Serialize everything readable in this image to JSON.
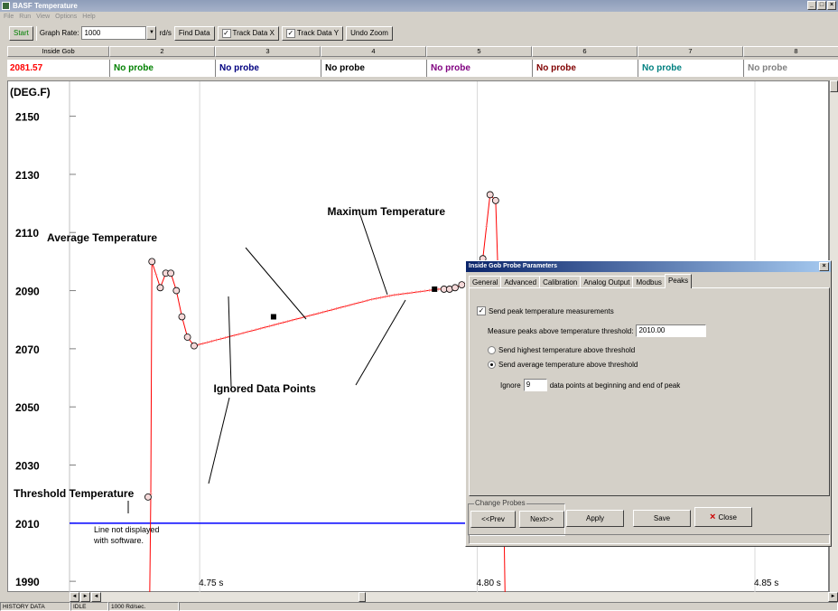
{
  "window": {
    "title": "BASF Temperature",
    "controls": [
      "_",
      "□",
      "×"
    ]
  },
  "menu": [
    "File",
    "Run",
    "View",
    "Options",
    "Help"
  ],
  "toolbar": {
    "start_label": "Start",
    "graph_rate_label": "Graph Rate:",
    "graph_rate_value": "1000",
    "graph_rate_unit": "rd/s",
    "find_data_label": "Find Data",
    "track_x_label": "Track Data X",
    "track_y_label": "Track Data Y",
    "undo_zoom_label": "Undo Zoom",
    "check_mark": "✓"
  },
  "channels": [
    {
      "header": "Inside Gob",
      "value": "2081.57",
      "color": "#ff0000"
    },
    {
      "header": "2",
      "value": "No probe",
      "color": "#008000"
    },
    {
      "header": "3",
      "value": "No probe",
      "color": "#000080"
    },
    {
      "header": "4",
      "value": "No probe",
      "color": "#000000"
    },
    {
      "header": "5",
      "value": "No probe",
      "color": "#800080"
    },
    {
      "header": "6",
      "value": "No probe",
      "color": "#800000"
    },
    {
      "header": "7",
      "value": "No probe",
      "color": "#008080"
    },
    {
      "header": "8",
      "value": "No probe",
      "color": "#808080"
    }
  ],
  "chart_data": {
    "type": "line",
    "ylabel": "(DEG.F)",
    "y_ticks": [
      "2150",
      "2130",
      "2110",
      "2090",
      "2070",
      "2050",
      "2030",
      "2010",
      "1990"
    ],
    "x_ticks": [
      "4.75 s",
      "4.80 s",
      "4.85 s"
    ],
    "ylim": [
      1986,
      2162
    ],
    "xlim": [
      4.7155,
      4.8635
    ],
    "grid": true,
    "threshold": 2010,
    "threshold_color": "#0000ff",
    "series_color": "#ff0000",
    "series": [
      {
        "values": [
          [
            4.741,
            1985
          ],
          [
            4.7412,
            2020
          ],
          [
            4.7414,
            2100
          ],
          [
            4.7429,
            2091
          ],
          [
            4.7439,
            2096
          ],
          [
            4.7448,
            2096
          ],
          [
            4.7458,
            2090
          ],
          [
            4.7468,
            2081
          ],
          [
            4.7478,
            2074
          ],
          [
            4.749,
            2071
          ],
          [
            4.753,
            2073
          ],
          [
            4.757,
            2075
          ],
          [
            4.761,
            2077
          ],
          [
            4.765,
            2079
          ],
          [
            4.769,
            2081
          ],
          [
            4.773,
            2083
          ],
          [
            4.777,
            2085
          ],
          [
            4.781,
            2087
          ],
          [
            4.785,
            2088.5
          ],
          [
            4.789,
            2089.5
          ],
          [
            4.793,
            2090.5
          ],
          [
            4.794,
            2090.5
          ],
          [
            4.795,
            2090.5
          ],
          [
            4.796,
            2091
          ],
          [
            4.7972,
            2092
          ],
          [
            4.7984,
            2093
          ],
          [
            4.7996,
            2095
          ],
          [
            4.801,
            2101
          ],
          [
            4.8023,
            2123
          ],
          [
            4.8033,
            2121
          ],
          [
            4.8045,
            2050
          ],
          [
            4.805,
            1985
          ]
        ]
      }
    ],
    "markers": [
      [
        4.7414,
        2100
      ],
      [
        4.7429,
        2091
      ],
      [
        4.7439,
        2096
      ],
      [
        4.7448,
        2096
      ],
      [
        4.7458,
        2090
      ],
      [
        4.7468,
        2081
      ],
      [
        4.7478,
        2074
      ],
      [
        4.749,
        2071
      ],
      [
        4.794,
        2090.5
      ],
      [
        4.795,
        2090.5
      ],
      [
        4.796,
        2091
      ],
      [
        4.7972,
        2092
      ],
      [
        4.7984,
        2093
      ],
      [
        4.7996,
        2095
      ],
      [
        4.801,
        2101
      ],
      [
        4.8023,
        2123
      ],
      [
        4.8033,
        2121
      ],
      [
        4.7407,
        2019
      ]
    ],
    "key_points": [
      [
        4.7633,
        2081
      ],
      [
        4.7923,
        2090.5
      ]
    ],
    "annotations": [
      {
        "text": "Maximum Temperature",
        "at": [
          4.773,
          2116
        ]
      },
      {
        "text": "Average Temperature",
        "at": [
          4.7225,
          2107
        ]
      },
      {
        "text": "Ignored Data Points",
        "at": [
          4.7525,
          2055
        ]
      },
      {
        "text": "Threshold Temperature",
        "at": [
          4.7165,
          2019
        ]
      }
    ],
    "notes": [
      "Line not displayed",
      "with software."
    ]
  },
  "dialog": {
    "title": "Inside Gob Probe Parameters",
    "close_glyph": "×",
    "tabs": [
      "General",
      "Advanced",
      "Calibration",
      "Analog Output",
      "Modbus",
      "Peaks"
    ],
    "active_tab": "Peaks",
    "send_peak_label": "Send peak temperature measurements",
    "threshold_label": "Measure peaks above temperature threshold:",
    "threshold_value": "2010.00",
    "radio_highest": "Send highest temperature above threshold",
    "radio_average": "Send average temperature above threshold",
    "ignore_label": "Ignore",
    "ignore_value": "9",
    "ignore_suffix": "data points at beginning and end of peak",
    "change_probes_label": "Change Probes",
    "prev_label": "<<Prev",
    "next_label": "Next>>",
    "apply_label": "Apply",
    "save_label": "Save",
    "close_label": "Close"
  },
  "scrollbar": {
    "left_arrow": "◄",
    "right_arrow": "►"
  },
  "status": [
    "HISTORY DATA",
    "IDLE",
    "1000 Rd/sec."
  ]
}
